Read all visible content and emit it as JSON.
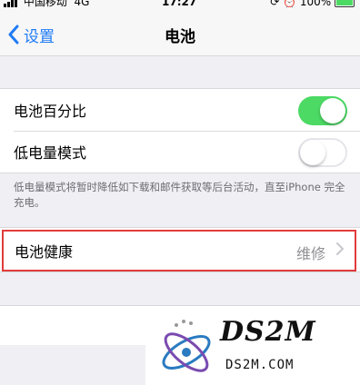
{
  "status_bar": {
    "carrier": "中国移动",
    "network": "4G",
    "time": "17:27",
    "battery_percent": "100%",
    "battery_color": "#4cd964"
  },
  "nav": {
    "back_label": "设置",
    "back_icon": "chevron-left-icon",
    "title": "电池"
  },
  "settings": {
    "battery_percentage": {
      "label": "电池百分比",
      "enabled": true
    },
    "low_power_mode": {
      "label": "低电量模式",
      "enabled": false
    },
    "low_power_note": "低电量模式将暂时降低如下载和邮件获取等后台活动，直至iPhone 完全充电。"
  },
  "battery_health": {
    "label": "电池健康",
    "value": "维修",
    "chevron_icon": "chevron-right-icon",
    "highlight_color": "#e23b3b"
  },
  "watermark": {
    "logo_text": "DS2M",
    "url": "DS2M.COM"
  },
  "colors": {
    "accent": "#1f7bf6",
    "switch_on": "#4cd964",
    "background": "#efeff4"
  }
}
